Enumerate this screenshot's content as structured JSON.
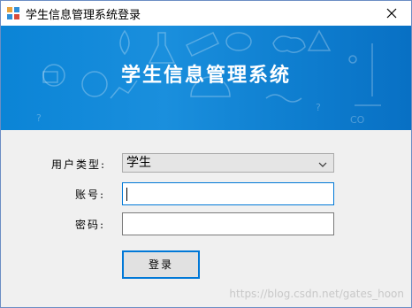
{
  "window": {
    "title": "学生信息管理系统登录"
  },
  "banner": {
    "title": "学生信息管理系统"
  },
  "form": {
    "user_type_label": "用户类型:",
    "user_type_value": "学生",
    "account_label": "账号:",
    "account_value": "",
    "password_label": "密码:",
    "password_value": "",
    "login_label": "登录"
  },
  "watermark": {
    "text": "https://blog.csdn.net/gates_hoon"
  },
  "colors": {
    "banner_blue": "#0b84d6",
    "focus_blue": "#0078d7",
    "window_bg": "#f0f0f0"
  },
  "icons": {
    "app": "app-icon",
    "close": "close-icon",
    "dropdown": "chevron-down-icon"
  }
}
